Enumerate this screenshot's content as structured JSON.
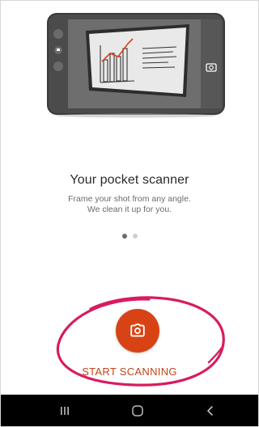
{
  "onboarding": {
    "title": "Your pocket scanner",
    "subtitle_line1": "Frame your shot from any angle.",
    "subtitle_line2": "We clean it up for you.",
    "page_indicator": {
      "current_page": 1,
      "total_pages": 2
    },
    "illustration": "phone-scanning-whiteboard-illustration"
  },
  "start_scanning": {
    "icon": "camera-icon",
    "label": "START SCANNING",
    "color": "#d84315"
  },
  "annotation": {
    "type": "hand-drawn-circle",
    "color": "#d81b60"
  },
  "system_nav": {
    "recents_icon": "recents-icon",
    "home_icon": "home-icon",
    "back_icon": "back-icon"
  }
}
